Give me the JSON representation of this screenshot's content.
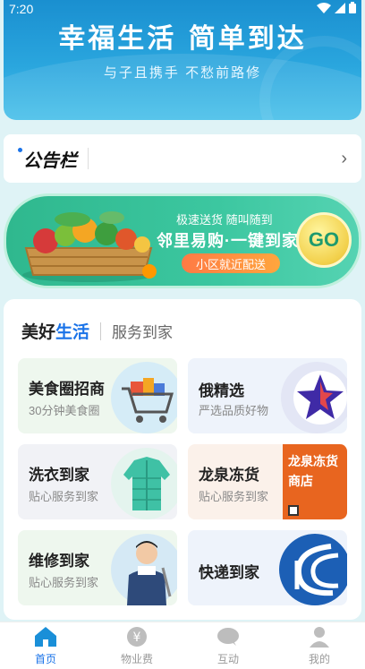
{
  "status": {
    "time": "7:20"
  },
  "hero": {
    "title": "幸福生活 简单到达",
    "subtitle": "与子且携手  不愁前路修"
  },
  "notice": {
    "logo_text": "公告栏",
    "arrow": "›"
  },
  "delivery": {
    "line1": "极速送货 随叫随到",
    "line2": "邻里易购·一键到家",
    "pill": "小区就近配送",
    "go_label": "GO"
  },
  "services": {
    "title_prefix": "美好",
    "title_highlight": "生活",
    "subtitle": "服务到家",
    "tiles": [
      {
        "title": "美食圈招商",
        "desc": "30分钟美食圈",
        "icon": "shopping-cart-icon"
      },
      {
        "title": "俄精选",
        "desc": "严选品质好物",
        "icon": "star-icon"
      },
      {
        "title": "洗衣到家",
        "desc": "贴心服务到家",
        "icon": "jacket-icon"
      },
      {
        "title": "龙泉冻货",
        "desc": "贴心服务到家",
        "icon": "store-sign-icon",
        "sign_text": "龙泉冻货商店"
      },
      {
        "title": "维修到家",
        "desc": "贴心服务到家",
        "icon": "technician-icon"
      },
      {
        "title": "快递到家",
        "desc": "",
        "icon": "courier-logo-icon"
      }
    ]
  },
  "nav": {
    "items": [
      {
        "label": "首页",
        "icon": "home-icon",
        "active": true
      },
      {
        "label": "物业费",
        "icon": "yuan-icon",
        "active": false
      },
      {
        "label": "互动",
        "icon": "chat-icon",
        "active": false
      },
      {
        "label": "我的",
        "icon": "user-icon",
        "active": false
      }
    ]
  },
  "colors": {
    "accent": "#1a73e8",
    "hero": "#2aa6de",
    "delivery": "#3cc7a0"
  }
}
